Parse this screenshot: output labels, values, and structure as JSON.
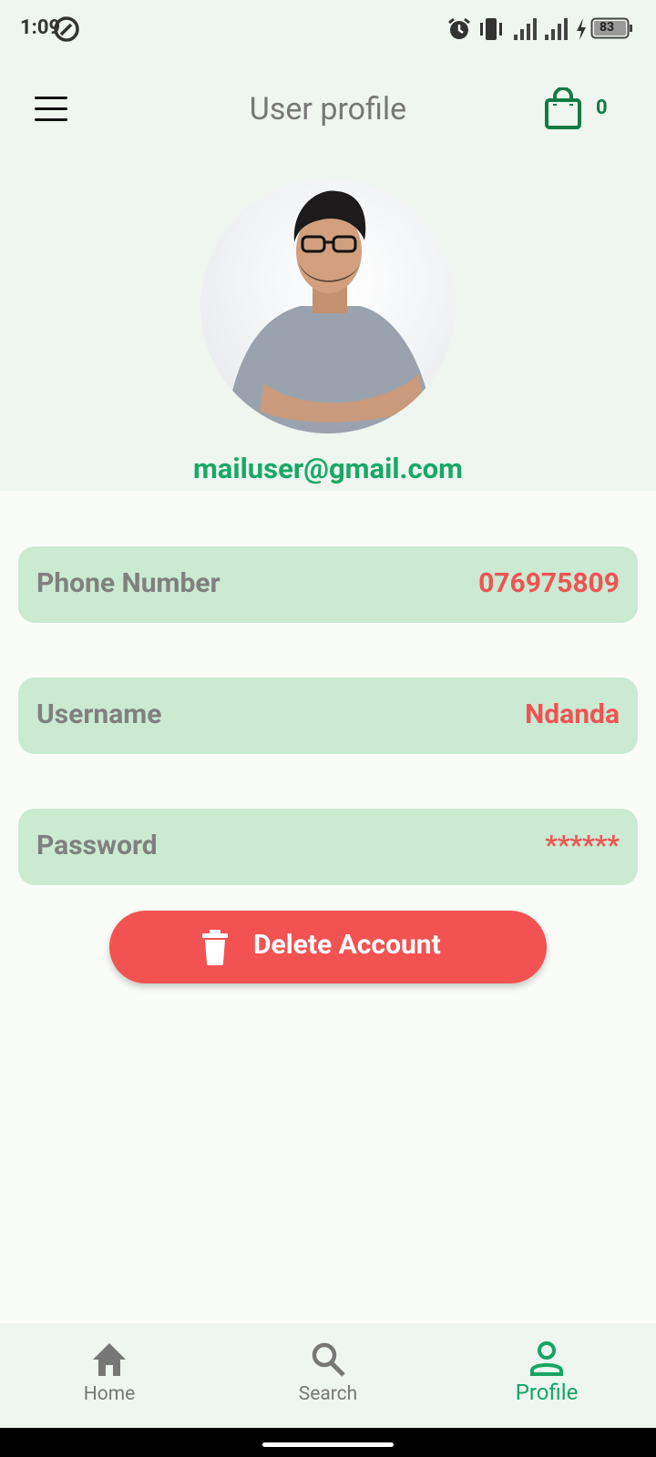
{
  "status_bar": {
    "time": "1:09",
    "battery": "83"
  },
  "app_bar": {
    "title": "User profile",
    "cart_count": "0"
  },
  "profile": {
    "email": "mailuser@gmail.com",
    "fields": [
      {
        "label": "Phone Number",
        "value": "076975809"
      },
      {
        "label": "Username",
        "value": "Ndanda"
      },
      {
        "label": "Password",
        "value": "******"
      }
    ],
    "delete_label": "Delete Account"
  },
  "bottom_nav": {
    "items": [
      {
        "label": "Home",
        "icon": "home-icon"
      },
      {
        "label": "Search",
        "icon": "search-icon"
      },
      {
        "label": "Profile",
        "icon": "person-icon",
        "active": true
      }
    ]
  },
  "colors": {
    "accent": "#1aa866",
    "danger": "#f25252",
    "field_bg": "#cbead2",
    "top_bg": "#eef6ef"
  }
}
